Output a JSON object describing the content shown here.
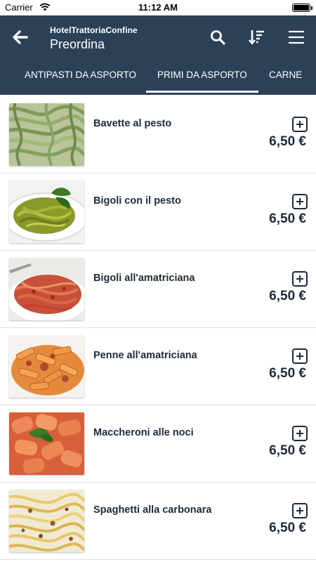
{
  "status_bar": {
    "carrier": "Carrier",
    "time": "11:12 AM"
  },
  "header": {
    "hotel_name": "HotelTrattoriaConfine",
    "title": "Preordina",
    "icons": {
      "back": "arrow-left-icon",
      "search": "search-icon",
      "sort": "sort-icon",
      "menu": "hamburger-menu-icon"
    }
  },
  "tabs": [
    {
      "label": "ANTIPASTI DA ASPORTO",
      "active": false
    },
    {
      "label": "PRIMI DA ASPORTO",
      "active": true
    },
    {
      "label": "CARNE",
      "active": false
    }
  ],
  "items": [
    {
      "name": "Bavette al pesto",
      "price": "6,50 €",
      "image": "pesto-pasta"
    },
    {
      "name": "Bigoli con il pesto",
      "price": "6,50 €",
      "image": "pesto-spaghetti-basil"
    },
    {
      "name": "Bigoli all'amatriciana",
      "price": "6,50 €",
      "image": "red-sauce-spaghetti"
    },
    {
      "name": "Penne all'amatriciana",
      "price": "6,50 €",
      "image": "penne-red-sauce"
    },
    {
      "name": "Maccheroni alle noci",
      "price": "6,50 €",
      "image": "rigatoni-pink-sauce-basil"
    },
    {
      "name": "Spaghetti alla carbonara",
      "price": "6,50 €",
      "image": "carbonara-spaghetti"
    }
  ],
  "colors": {
    "header_bg": "#2c4157",
    "text_dark": "#1d2a3a",
    "divider": "#e1e1e1"
  }
}
